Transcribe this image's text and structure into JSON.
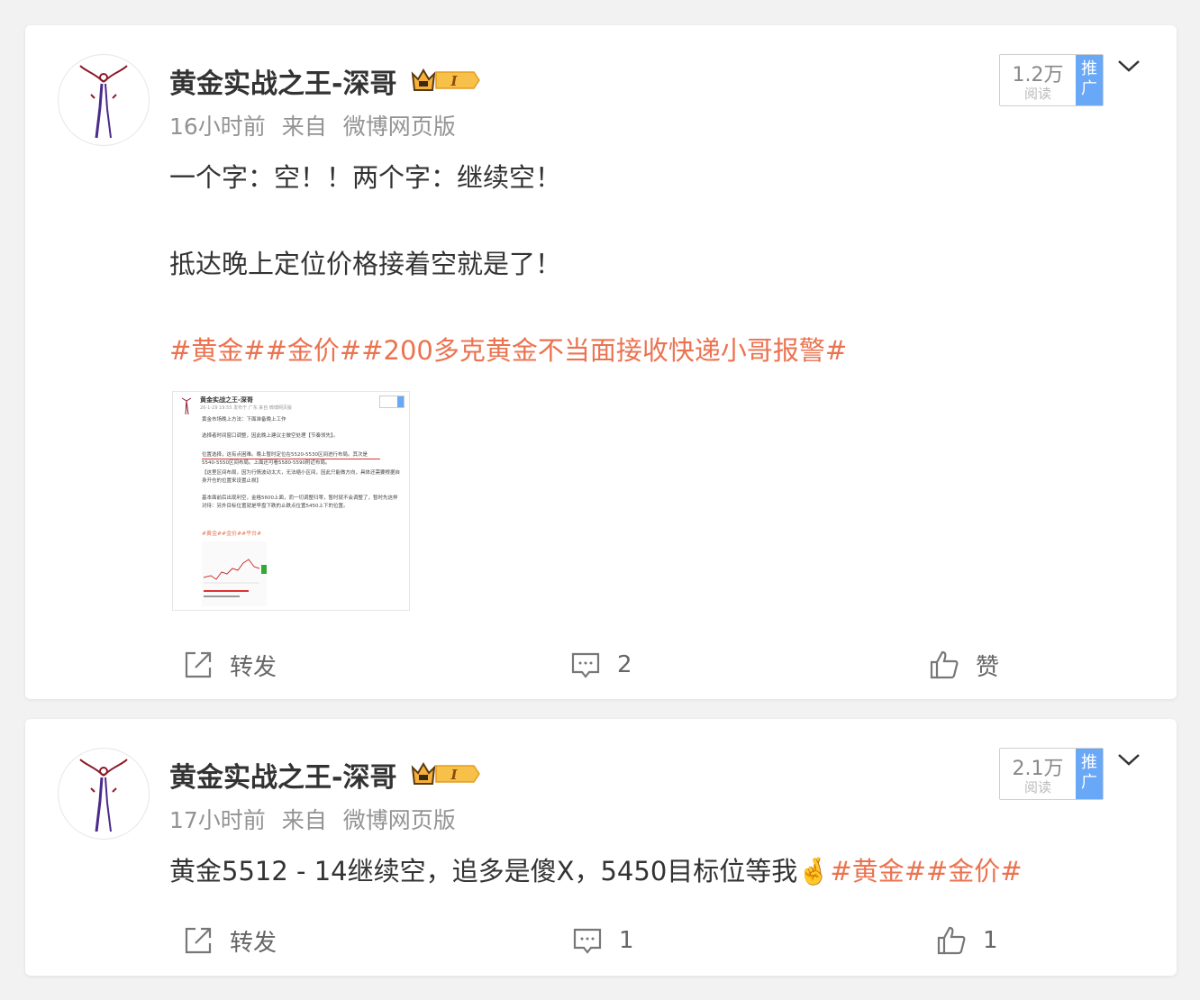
{
  "colors": {
    "tag": "#eb7350",
    "promo": "#69a7f7",
    "meta": "#939393"
  },
  "posts": [
    {
      "username": "黄金实战之王-深哥",
      "badge_level": "I",
      "time": "16小时前",
      "source_prefix": "来自",
      "source": "微博网页版",
      "reads": {
        "count": "1.2万",
        "label": "阅读",
        "promo": "推广"
      },
      "lines": [
        "一个字：空！！两个字：继续空！",
        "抵达晚上定位价格接着空就是了！"
      ],
      "hashtags": "#黄金##金价##200多克黄金不当面接收快递小哥报警#",
      "thumbnail": {
        "title": "黄金实战之王-深哥",
        "meta": "26-1-29 19:55 发布于 广东 来自 微博网页版",
        "lines": [
          "黄金市场晚上方法：下面准备晚上工作",
          "选择者时间窗口调整，因此晚上建议主做空处理【节奏领先】。",
          "位置选择，这有点困难。晚上暂时定位在5520-5530区间进行布局。其次是5540-5550区间布局。上面还可看5580-5590附近布局。",
          "【这里区间布局，因为行情波动太大，无法缩小区间，因此只能做方向，具体还需要根据自身开仓的位置来设置止损】",
          "基本面前后出现利空，金格5600上面，而一切调整归零，暂时就不会调整了，暂时先这样对待：另外目标位置就是早盘下跌的止跌点位置5450上下的位置。"
        ],
        "tags": "#黄金##金价##平台#"
      },
      "actions": {
        "repost": "转发",
        "comments": "2",
        "likes": "赞"
      }
    },
    {
      "username": "黄金实战之王-深哥",
      "badge_level": "I",
      "time": "17小时前",
      "source_prefix": "来自",
      "source": "微博网页版",
      "reads": {
        "count": "2.1万",
        "label": "阅读",
        "promo": "推广"
      },
      "text": "黄金5512 - 14继续空，追多是傻X，5450目标位等我",
      "emoji": "🤞",
      "hashtags": "#黄金##金价#",
      "actions": {
        "repost": "转发",
        "comments": "1",
        "likes": "1"
      }
    }
  ]
}
